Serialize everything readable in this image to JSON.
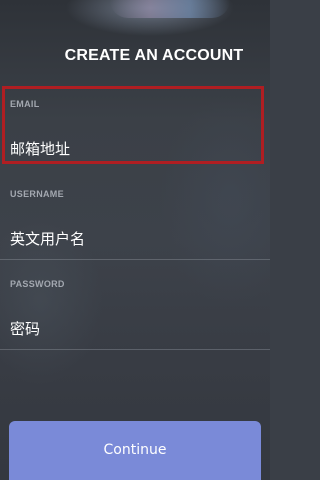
{
  "header": {
    "title": "CREATE AN ACCOUNT"
  },
  "form": {
    "email": {
      "label": "EMAIL",
      "value": "邮箱地址"
    },
    "username": {
      "label": "USERNAME",
      "value": "英文用户名"
    },
    "password": {
      "label": "PASSWORD",
      "value": "密码"
    },
    "continue_label": "Continue"
  },
  "colors": {
    "accent": "#7a8ad8",
    "highlight": "#b01e22",
    "label": "#a3a8b0"
  }
}
